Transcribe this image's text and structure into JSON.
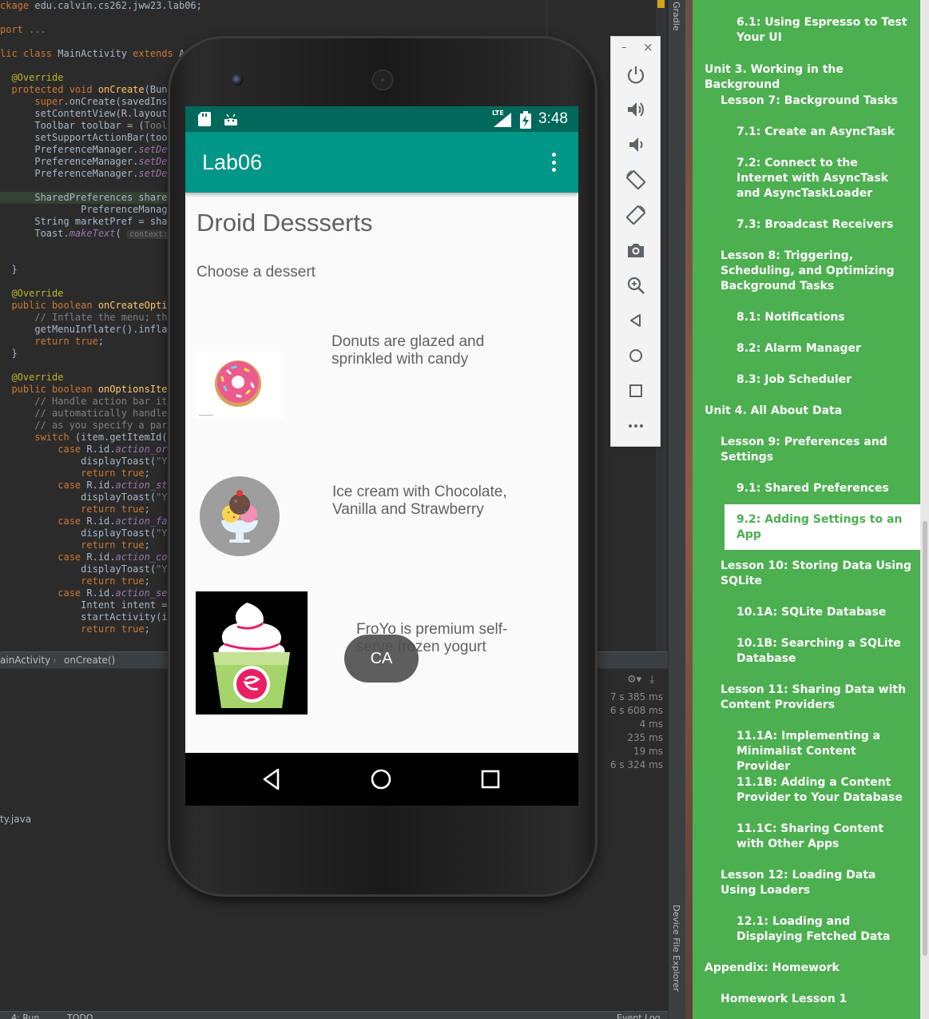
{
  "ide": {
    "code": [
      [
        {
          "t": "ckage ",
          "c": "kw"
        },
        {
          "t": "edu.calvin.cs262.jww23.lab06;",
          "c": ""
        }
      ],
      [
        {
          "t": "port ",
          "c": "kw"
        },
        {
          "t": "...",
          "c": "st"
        }
      ],
      [
        {
          "t": "lic class ",
          "c": "kw"
        },
        {
          "t": "MainActivity ",
          "c": ""
        },
        {
          "t": "extends ",
          "c": "kw"
        },
        {
          "t": "Ap",
          "c": ""
        }
      ],
      [
        {
          "t": "  @Override",
          "c": "an"
        }
      ],
      [
        {
          "t": "  protected void ",
          "c": "kw"
        },
        {
          "t": "onCreate",
          "c": "fn"
        },
        {
          "t": "(Bund",
          "c": ""
        }
      ],
      [
        {
          "t": "      super",
          "c": "kw"
        },
        {
          "t": ".onCreate(savedInst",
          "c": ""
        }
      ],
      [
        {
          "t": "      setContentView(R.layout.",
          "c": ""
        }
      ],
      [
        {
          "t": "      Toolbar toolbar = (",
          "c": ""
        },
        {
          "t": "Toolb",
          "c": "cm"
        }
      ],
      [
        {
          "t": "      setSupportActionBar(tool",
          "c": ""
        }
      ],
      [
        {
          "t": "      PreferenceManager.",
          "c": ""
        },
        {
          "t": "setDef",
          "c": "it"
        }
      ],
      [
        {
          "t": "      PreferenceManager.",
          "c": ""
        },
        {
          "t": "setDef",
          "c": "it"
        }
      ],
      [
        {
          "t": "      PreferenceManager.",
          "c": ""
        },
        {
          "t": "setDef",
          "c": "it"
        }
      ],
      [
        {
          "t": "      SharedPreferences shared",
          "c": ""
        }
      ],
      [
        {
          "t": "              PreferenceManag",
          "c": ""
        }
      ],
      [
        {
          "t": "      String marketPref = sha",
          "c": ""
        }
      ],
      [
        {
          "t": "      Toast.",
          "c": ""
        },
        {
          "t": "makeText",
          "c": "it"
        },
        {
          "t": "( ",
          "c": ""
        },
        {
          "t": "context:",
          "c": "hint"
        }
      ],
      [
        {
          "t": "  }",
          "c": ""
        }
      ],
      [
        {
          "t": "  @Override",
          "c": "an"
        }
      ],
      [
        {
          "t": "  public boolean ",
          "c": "kw"
        },
        {
          "t": "onCreateOptio",
          "c": "fn"
        }
      ],
      [
        {
          "t": "      // Inflate the menu; thi",
          "c": "cm"
        }
      ],
      [
        {
          "t": "      getMenuInflater().infla",
          "c": ""
        }
      ],
      [
        {
          "t": "      return true",
          "c": "kw"
        },
        {
          "t": ";",
          "c": ""
        }
      ],
      [
        {
          "t": "  }",
          "c": ""
        }
      ],
      [
        {
          "t": "  @Override",
          "c": "an"
        }
      ],
      [
        {
          "t": "  public boolean ",
          "c": "kw"
        },
        {
          "t": "onOptionsItem",
          "c": "fn"
        }
      ],
      [
        {
          "t": "      // Handle action bar ite",
          "c": "cm"
        }
      ],
      [
        {
          "t": "      // automatically handle ",
          "c": "cm"
        }
      ],
      [
        {
          "t": "      // as you specify a pare",
          "c": "cm"
        }
      ],
      [
        {
          "t": "      switch ",
          "c": "kw"
        },
        {
          "t": "(item.getItemId()",
          "c": ""
        }
      ],
      [
        {
          "t": "          case ",
          "c": "kw"
        },
        {
          "t": "R.id.",
          "c": ""
        },
        {
          "t": "action_ord",
          "c": "it"
        }
      ],
      [
        {
          "t": "              displayToast(",
          "c": ""
        },
        {
          "t": "\"Yo",
          "c": "st"
        }
      ],
      [
        {
          "t": "              return true",
          "c": "kw"
        },
        {
          "t": ";",
          "c": ""
        }
      ],
      [
        {
          "t": "          case ",
          "c": "kw"
        },
        {
          "t": "R.id.",
          "c": ""
        },
        {
          "t": "action_sta",
          "c": "it"
        }
      ],
      [
        {
          "t": "              displayToast(",
          "c": ""
        },
        {
          "t": "\"Yo",
          "c": "st"
        }
      ],
      [
        {
          "t": "              return true",
          "c": "kw"
        },
        {
          "t": ";",
          "c": ""
        }
      ],
      [
        {
          "t": "          case ",
          "c": "kw"
        },
        {
          "t": "R.id.",
          "c": ""
        },
        {
          "t": "action_fav",
          "c": "it"
        }
      ],
      [
        {
          "t": "              displayToast(",
          "c": ""
        },
        {
          "t": "\"Yo",
          "c": "st"
        }
      ],
      [
        {
          "t": "              return true",
          "c": "kw"
        },
        {
          "t": ";",
          "c": ""
        }
      ],
      [
        {
          "t": "          case ",
          "c": "kw"
        },
        {
          "t": "R.id.",
          "c": ""
        },
        {
          "t": "action_con",
          "c": "it"
        }
      ],
      [
        {
          "t": "              displayToast(",
          "c": ""
        },
        {
          "t": "\"Yo",
          "c": "st"
        }
      ],
      [
        {
          "t": "              return true",
          "c": "kw"
        },
        {
          "t": ";",
          "c": ""
        }
      ],
      [
        {
          "t": "          case ",
          "c": "kw"
        },
        {
          "t": "R.id.",
          "c": ""
        },
        {
          "t": "action_set",
          "c": "it"
        }
      ],
      [
        {
          "t": "              Intent intent = ",
          "c": ""
        }
      ],
      [
        {
          "t": "              startActivity(in",
          "c": ""
        }
      ],
      [
        {
          "t": "              return true",
          "c": "kw"
        },
        {
          "t": ";",
          "c": ""
        }
      ]
    ],
    "breadcrumb": [
      "ainActivity",
      "onCreate()"
    ],
    "timings": [
      "7 s 385 ms",
      "6 s 608 ms",
      "4 ms",
      "235 ms",
      "19 ms",
      "6 s 324 ms"
    ],
    "file_ref": "ty.java",
    "side_tools": {
      "gradle": "Gradle",
      "device_explorer": "Device File Explorer"
    },
    "status": {
      "run": "4: Run",
      "todo": "TODO",
      "event_log": "Event Log"
    }
  },
  "emulator_toolbar": {
    "items": [
      "power-icon",
      "volume-up-icon",
      "volume-down-icon",
      "rotate-left-icon",
      "rotate-right-icon",
      "camera-icon",
      "zoom-icon",
      "back-icon",
      "home-icon",
      "overview-icon",
      "more-icon"
    ],
    "minimize": "–",
    "close": "×"
  },
  "phone": {
    "status_bar": {
      "time": "3:48",
      "network": "LTE"
    },
    "app_bar": {
      "title": "Lab06"
    },
    "content": {
      "title": "Droid Dessserts",
      "subtitle": "Choose a dessert",
      "desserts": [
        {
          "description": "Donuts are glazed and sprinkled with candy",
          "icon": "donut-image"
        },
        {
          "description": "Ice cream with Chocolate, Vanilla and Strawberry",
          "icon": "ice-cream-image"
        },
        {
          "description": "FroYo is premium self-serve frozen yogurt",
          "icon": "froyo-image"
        }
      ]
    },
    "toast": "CA",
    "colors": {
      "primary": "#009688",
      "primary_dark": "#00695c"
    }
  },
  "toc": {
    "items": [
      {
        "label": "6.1: Using Espresso to Test Your UI",
        "level": 3
      },
      {
        "label": "Unit 3. Working in the Background",
        "level": 1
      },
      {
        "label": "Lesson 7: Background Tasks",
        "level": 2
      },
      {
        "label": "7.1: Create an AsyncTask",
        "level": 3
      },
      {
        "label": "7.2: Connect to the Internet with AsyncTask and AsyncTaskLoader",
        "level": 3
      },
      {
        "label": "7.3: Broadcast Receivers",
        "level": 3
      },
      {
        "label": "Lesson 8: Triggering, Scheduling, and Optimizing Background Tasks",
        "level": 2
      },
      {
        "label": "8.1: Notifications",
        "level": 3
      },
      {
        "label": "8.2: Alarm Manager",
        "level": 3
      },
      {
        "label": "8.3: Job Scheduler",
        "level": 3
      },
      {
        "label": "Unit 4. All About Data",
        "level": 1
      },
      {
        "label": "Lesson 9: Preferences and Settings",
        "level": 2
      },
      {
        "label": "9.1: Shared Preferences",
        "level": 3
      },
      {
        "label": "9.2: Adding Settings to an App",
        "level": 3,
        "active": true
      },
      {
        "label": "Lesson 10: Storing Data Using SQLite",
        "level": 2
      },
      {
        "label": "10.1A: SQLite Database",
        "level": 3
      },
      {
        "label": "10.1B: Searching a SQLite Database",
        "level": 3
      },
      {
        "label": "Lesson 11: Sharing Data with Content Providers",
        "level": 2
      },
      {
        "label": "11.1A: Implementing a Minimalist Content Provider",
        "level": 3
      },
      {
        "label": "11.1B: Adding a Content Provider to Your Database",
        "level": 3
      },
      {
        "label": "11.1C: Sharing Content with Other Apps",
        "level": 3
      },
      {
        "label": "Lesson 12: Loading Data Using Loaders",
        "level": 2
      },
      {
        "label": "12.1: Loading and Displaying Fetched Data",
        "level": 3
      },
      {
        "label": "Appendix: Homework",
        "level": 1
      },
      {
        "label": "Homework Lesson 1",
        "level": 2
      }
    ],
    "colors": {
      "background": "#4caf50",
      "text": "#ffffff",
      "active_text": "#4caf50"
    }
  }
}
